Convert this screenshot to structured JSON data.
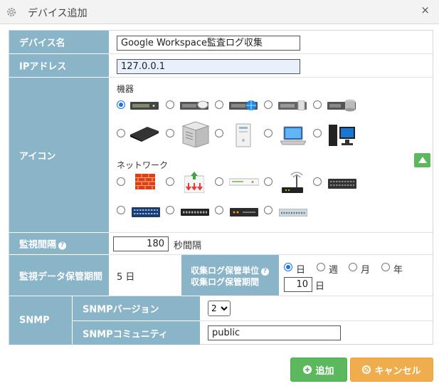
{
  "dialog": {
    "title": "デバイス追加",
    "close_glyph": "×"
  },
  "fields": {
    "device_name": {
      "label": "デバイス名",
      "value": "Google  Workspace監査ログ収集"
    },
    "ip_address": {
      "label": "IPアドレス",
      "value": "127.0.0.1"
    },
    "icon": {
      "label": "アイコン",
      "sections": [
        {
          "title": "機器",
          "icons": [
            "rack-server-icon",
            "rack-cloud-server-icon",
            "rack-globe-server-icon",
            "rack-gray-server-icon",
            "database-server-icon",
            "nas-device-icon",
            "tower-server-icon",
            "desktop-tower-icon",
            "laptop-icon",
            "desktop-pc-icon"
          ],
          "selected": 0
        },
        {
          "title": "ネットワーク",
          "icons": [
            "firewall-icon",
            "download-gateway-icon",
            "flat-switch-icon",
            "wireless-router-icon",
            "black-switch-icon",
            "blue-switch-icon",
            "patch-panel-icon",
            "dark-router-icon",
            "gray-hub-icon"
          ],
          "selected": -1
        }
      ]
    },
    "monitoring_interval": {
      "label": "監視間隔",
      "help": "?",
      "value": "180",
      "unit": "秒間隔"
    },
    "retention": {
      "label": "監視データ保管期間",
      "value": "5 日",
      "log_unit_label": "収集ログ保管単位",
      "log_period_label": "収集ログ保管期間",
      "help": "?",
      "units": [
        "日",
        "週",
        "月",
        "年"
      ],
      "selected_unit": 0,
      "period_value": "10",
      "period_unit": "日"
    },
    "snmp": {
      "label": "SNMP",
      "version_label": "SNMPバージョン",
      "version_value": "2",
      "community_label": "SNMPコミュニティ",
      "community_value": "public"
    }
  },
  "buttons": {
    "add": "追加",
    "cancel": "キャンセル"
  },
  "colors": {
    "label_bg": "#8ab4c8",
    "add": "#5cb85c",
    "cancel": "#f0ad4e",
    "radio": "#1a73e8"
  }
}
